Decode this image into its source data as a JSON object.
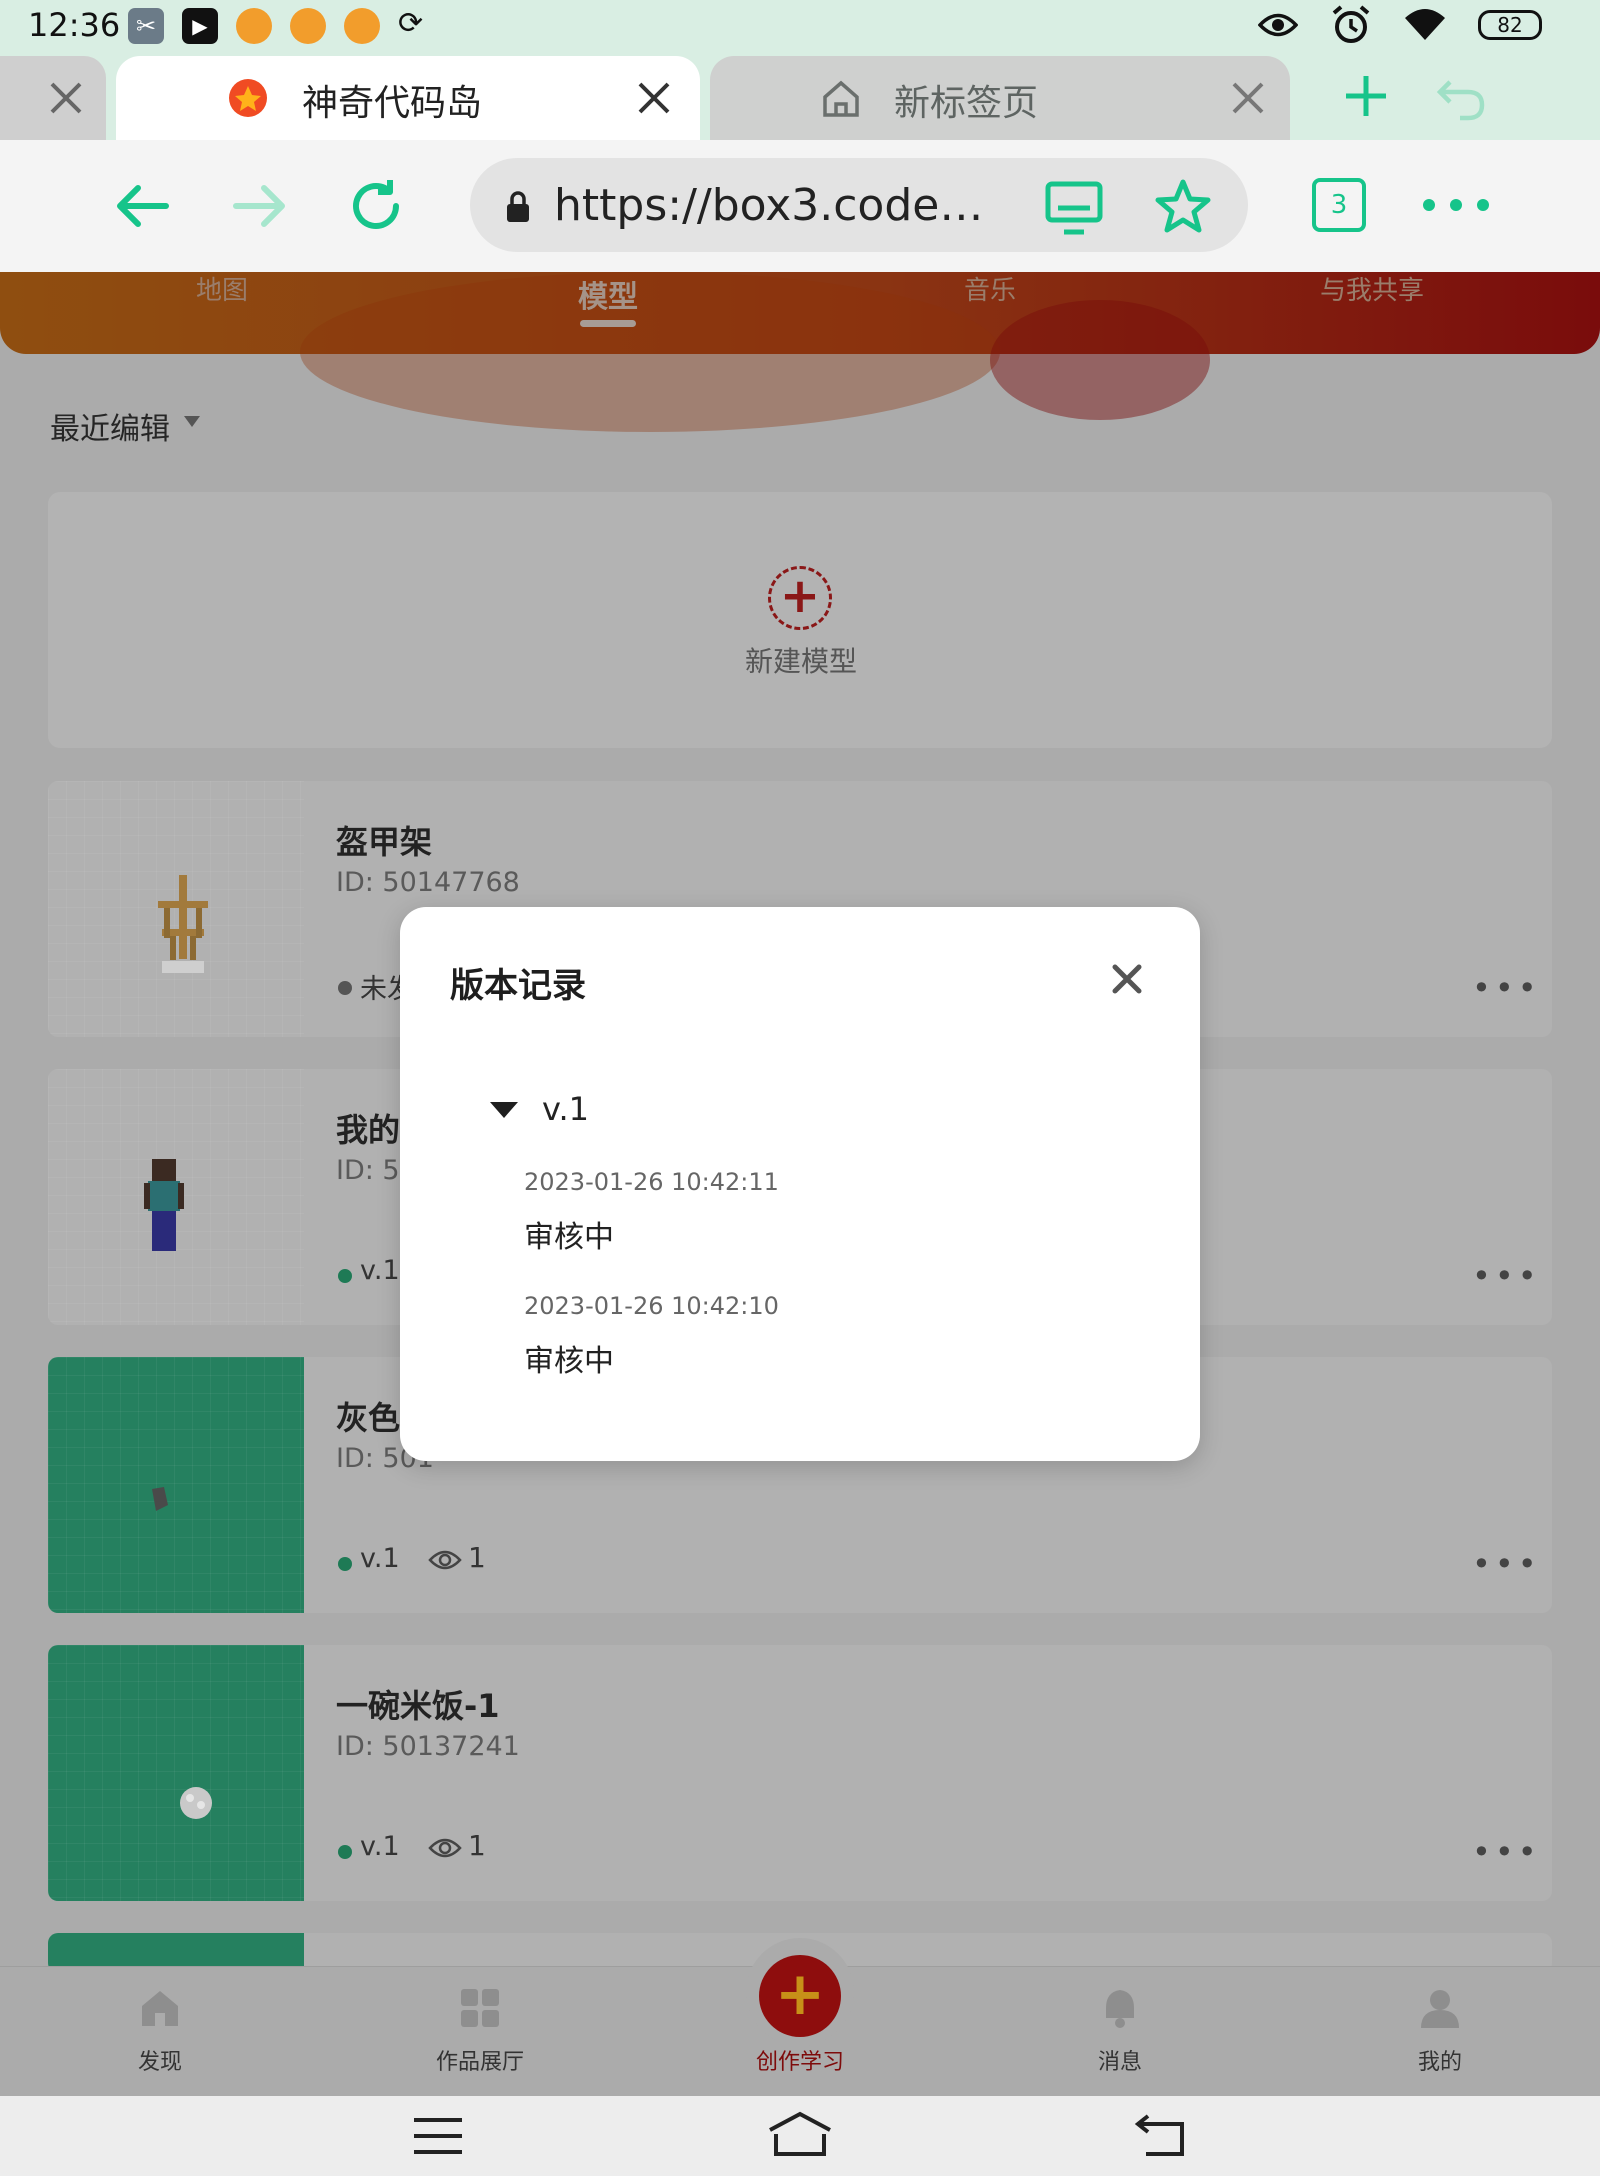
{
  "status_bar": {
    "time": "12:36",
    "battery": "82",
    "icons": [
      "scissors-icon",
      "capcut-icon",
      "fox-icon",
      "fox-icon",
      "fox-icon",
      "sync-icon",
      "eye-icon",
      "alarm-icon",
      "wifi-icon",
      "battery-icon"
    ]
  },
  "browser": {
    "tabs": [
      {
        "title": "神奇代码岛",
        "active": true,
        "icon": "codemao-logo-icon"
      },
      {
        "title": "新标签页",
        "active": false,
        "icon": "home-icon"
      }
    ],
    "url": "https://box3.codema...",
    "tab_count": "3",
    "accent_color": "#16c48a"
  },
  "page": {
    "top_tabs": [
      {
        "label": "地图",
        "active": false
      },
      {
        "label": "模型",
        "active": true
      },
      {
        "label": "音乐",
        "active": false
      },
      {
        "label": "与我共享",
        "active": false
      }
    ],
    "sort_label": "最近编辑",
    "new_model_label": "新建模型",
    "cards": [
      {
        "title": "盔甲架",
        "id": "ID: 50147768",
        "version": "未发",
        "status_color": "#555555",
        "views": ""
      },
      {
        "title": "我的",
        "id": "ID: 50",
        "version": "v.1",
        "status_color": "#1e7a55",
        "views": ""
      },
      {
        "title": "灰色",
        "id": "ID: 501",
        "version": "v.1",
        "status_color": "#1e7a55",
        "views": "1"
      },
      {
        "title": "一碗米饭-1",
        "id": "ID: 50137241",
        "version": "v.1",
        "status_color": "#1e7a55",
        "views": "1"
      }
    ],
    "more_label": "•••"
  },
  "bottom_nav": {
    "items": [
      {
        "label": "发现",
        "icon": "home-icon"
      },
      {
        "label": "作品展厅",
        "icon": "grid-icon"
      },
      {
        "label": "创作学习",
        "icon": "plus-icon"
      },
      {
        "label": "消息",
        "icon": "bell-icon"
      },
      {
        "label": "我的",
        "icon": "user-icon"
      }
    ],
    "accent_color": "#8e0d0d"
  },
  "modal": {
    "title": "版本记录",
    "version": "v.1",
    "entries": [
      {
        "time": "2023-01-26 10:42:11",
        "status": "审核中"
      },
      {
        "time": "2023-01-26 10:42:10",
        "status": "审核中"
      }
    ]
  }
}
